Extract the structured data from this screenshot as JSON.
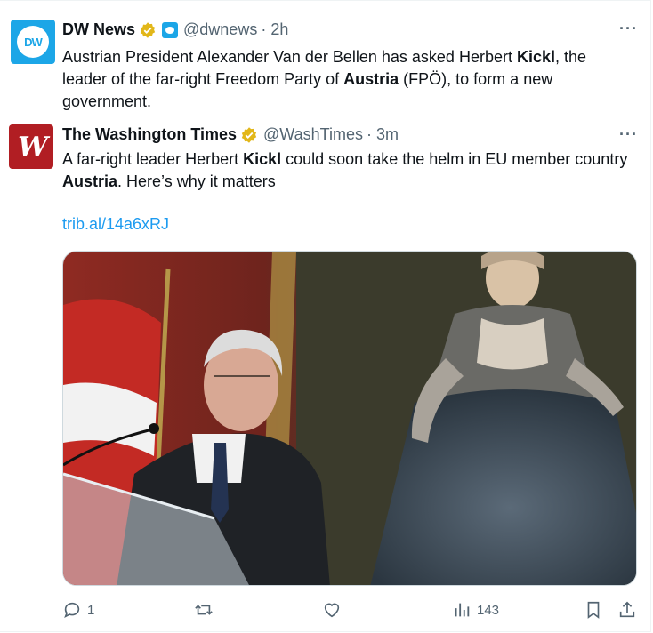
{
  "tweet1": {
    "name": "DW News",
    "handle": "@dwnews",
    "time": "· 2h",
    "avatar_text": "DW",
    "text_parts": [
      "Austrian President Alexander Van der Bellen has asked Herbert ",
      "Kickl",
      ", the leader of the far-right Freedom Party of ",
      "Austria",
      " (FPÖ), to form a new government."
    ],
    "more": "···"
  },
  "tweet2": {
    "name": "The Washington Times",
    "handle": "@WashTimes",
    "time": "· 3m",
    "avatar_text": "W",
    "text_parts": [
      "A far-right leader Herbert ",
      "Kickl",
      " could soon take the helm in EU member country ",
      "Austria",
      ". Here’s why it matters"
    ],
    "link": "trib.al/14a6xRJ",
    "more": "···"
  },
  "actions": {
    "reply_count": "1",
    "views_count": "143"
  },
  "colors": {
    "dw_blue": "#1ca6e7",
    "wt_red": "#b11e23",
    "link_blue": "#1d9bf0",
    "verified_gold": "#e2b719"
  },
  "icons": [
    "dw-logo",
    "verified-badge-icon",
    "affiliation-badge-icon",
    "more-icon",
    "reply-icon",
    "retweet-icon",
    "like-icon",
    "views-icon",
    "bookmark-icon",
    "share-icon"
  ]
}
